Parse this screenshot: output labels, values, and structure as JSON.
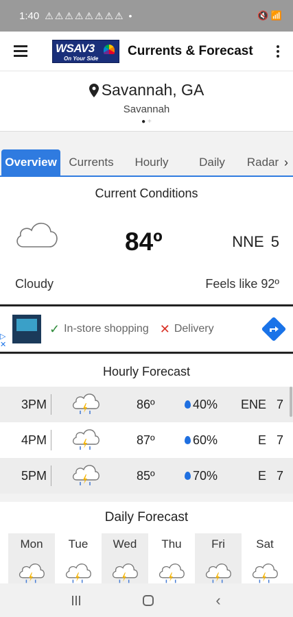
{
  "status_bar": {
    "time": "1:40",
    "notifications": "⚠⚠⚠⚠⚠⚠⚠⚠ •",
    "right_icons": "🔇 📶"
  },
  "app_bar": {
    "logo_text": "WSAV3",
    "logo_tagline": "On Your Side",
    "title": "Currents & Forecast"
  },
  "location": {
    "city": "Savannah, GA",
    "subtitle": "Savannah"
  },
  "tabs": [
    {
      "label": "Overview",
      "active": true
    },
    {
      "label": "Currents",
      "active": false
    },
    {
      "label": "Hourly",
      "active": false
    },
    {
      "label": "Daily",
      "active": false
    },
    {
      "label": "Radar",
      "active": false
    }
  ],
  "current_conditions": {
    "title": "Current Conditions",
    "temperature": "84º",
    "wind": "NNE 5",
    "condition": "Cloudy",
    "feels_like": "Feels like 92º"
  },
  "ad": {
    "option1": "In-store shopping",
    "option2": "Delivery",
    "check_glyph": "✓",
    "x_glyph": "✕",
    "accent": "#1a73e8"
  },
  "hourly": {
    "title": "Hourly Forecast",
    "rows": [
      {
        "time": "3PM",
        "temp": "86º",
        "rain": "40%",
        "wind": "ENE 7",
        "icon": "thunderstorm-icon"
      },
      {
        "time": "4PM",
        "temp": "87º",
        "rain": "60%",
        "wind": "E 7",
        "icon": "thunderstorm-icon"
      },
      {
        "time": "5PM",
        "temp": "85º",
        "rain": "70%",
        "wind": "E 7",
        "icon": "thunderstorm-icon"
      }
    ]
  },
  "daily": {
    "title": "Daily Forecast",
    "days": [
      {
        "day": "Mon",
        "icon": "thunderstorm-icon"
      },
      {
        "day": "Tue",
        "icon": "thunderstorm-icon"
      },
      {
        "day": "Wed",
        "icon": "thunderstorm-icon"
      },
      {
        "day": "Thu",
        "icon": "thunderstorm-icon"
      },
      {
        "day": "Fri",
        "icon": "thunderstorm-icon"
      },
      {
        "day": "Sat",
        "icon": "thunderstorm-icon"
      }
    ]
  },
  "colors": {
    "accent": "#2f7be0",
    "rain_drop": "#1f6fe0"
  }
}
